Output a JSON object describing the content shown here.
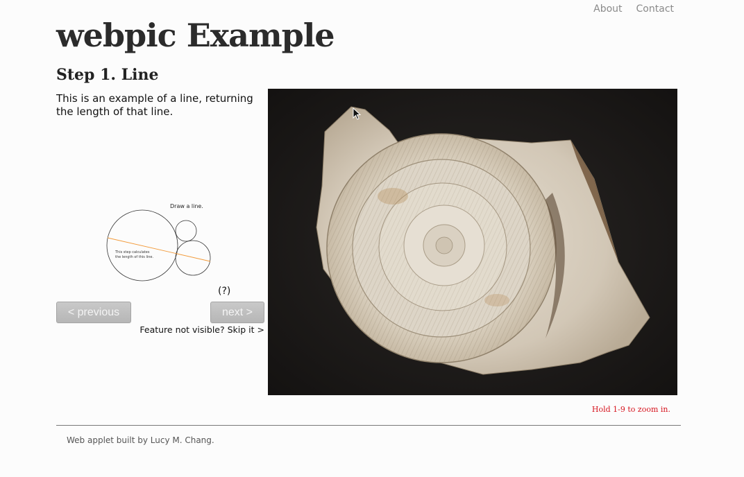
{
  "nav": {
    "about": "About",
    "contact": "Contact"
  },
  "site_title": "webpic Example",
  "step": {
    "title": "Step 1. Line",
    "description": "This is an example of a line, returning the length of that line."
  },
  "diagram": {
    "caption": "Draw a line.",
    "note_line1": "This step calculates",
    "note_line2": "the length of this line.",
    "line_color": "#f29a3a"
  },
  "help_label": "(?)",
  "buttons": {
    "previous": "< previous",
    "next": "next >"
  },
  "skip": {
    "text": "Feature not visible?",
    "link": "Skip it >"
  },
  "image": {
    "subject": "ammonite-fossil"
  },
  "zoom_hint": "Hold 1-9 to zoom in.",
  "footer": {
    "text": "Web applet built by",
    "author": "Lucy M. Chang."
  },
  "colors": {
    "zoom_hint": "#d6121c",
    "button_bg": "#bdbdbd",
    "photo_bg": "#1d1b19"
  }
}
